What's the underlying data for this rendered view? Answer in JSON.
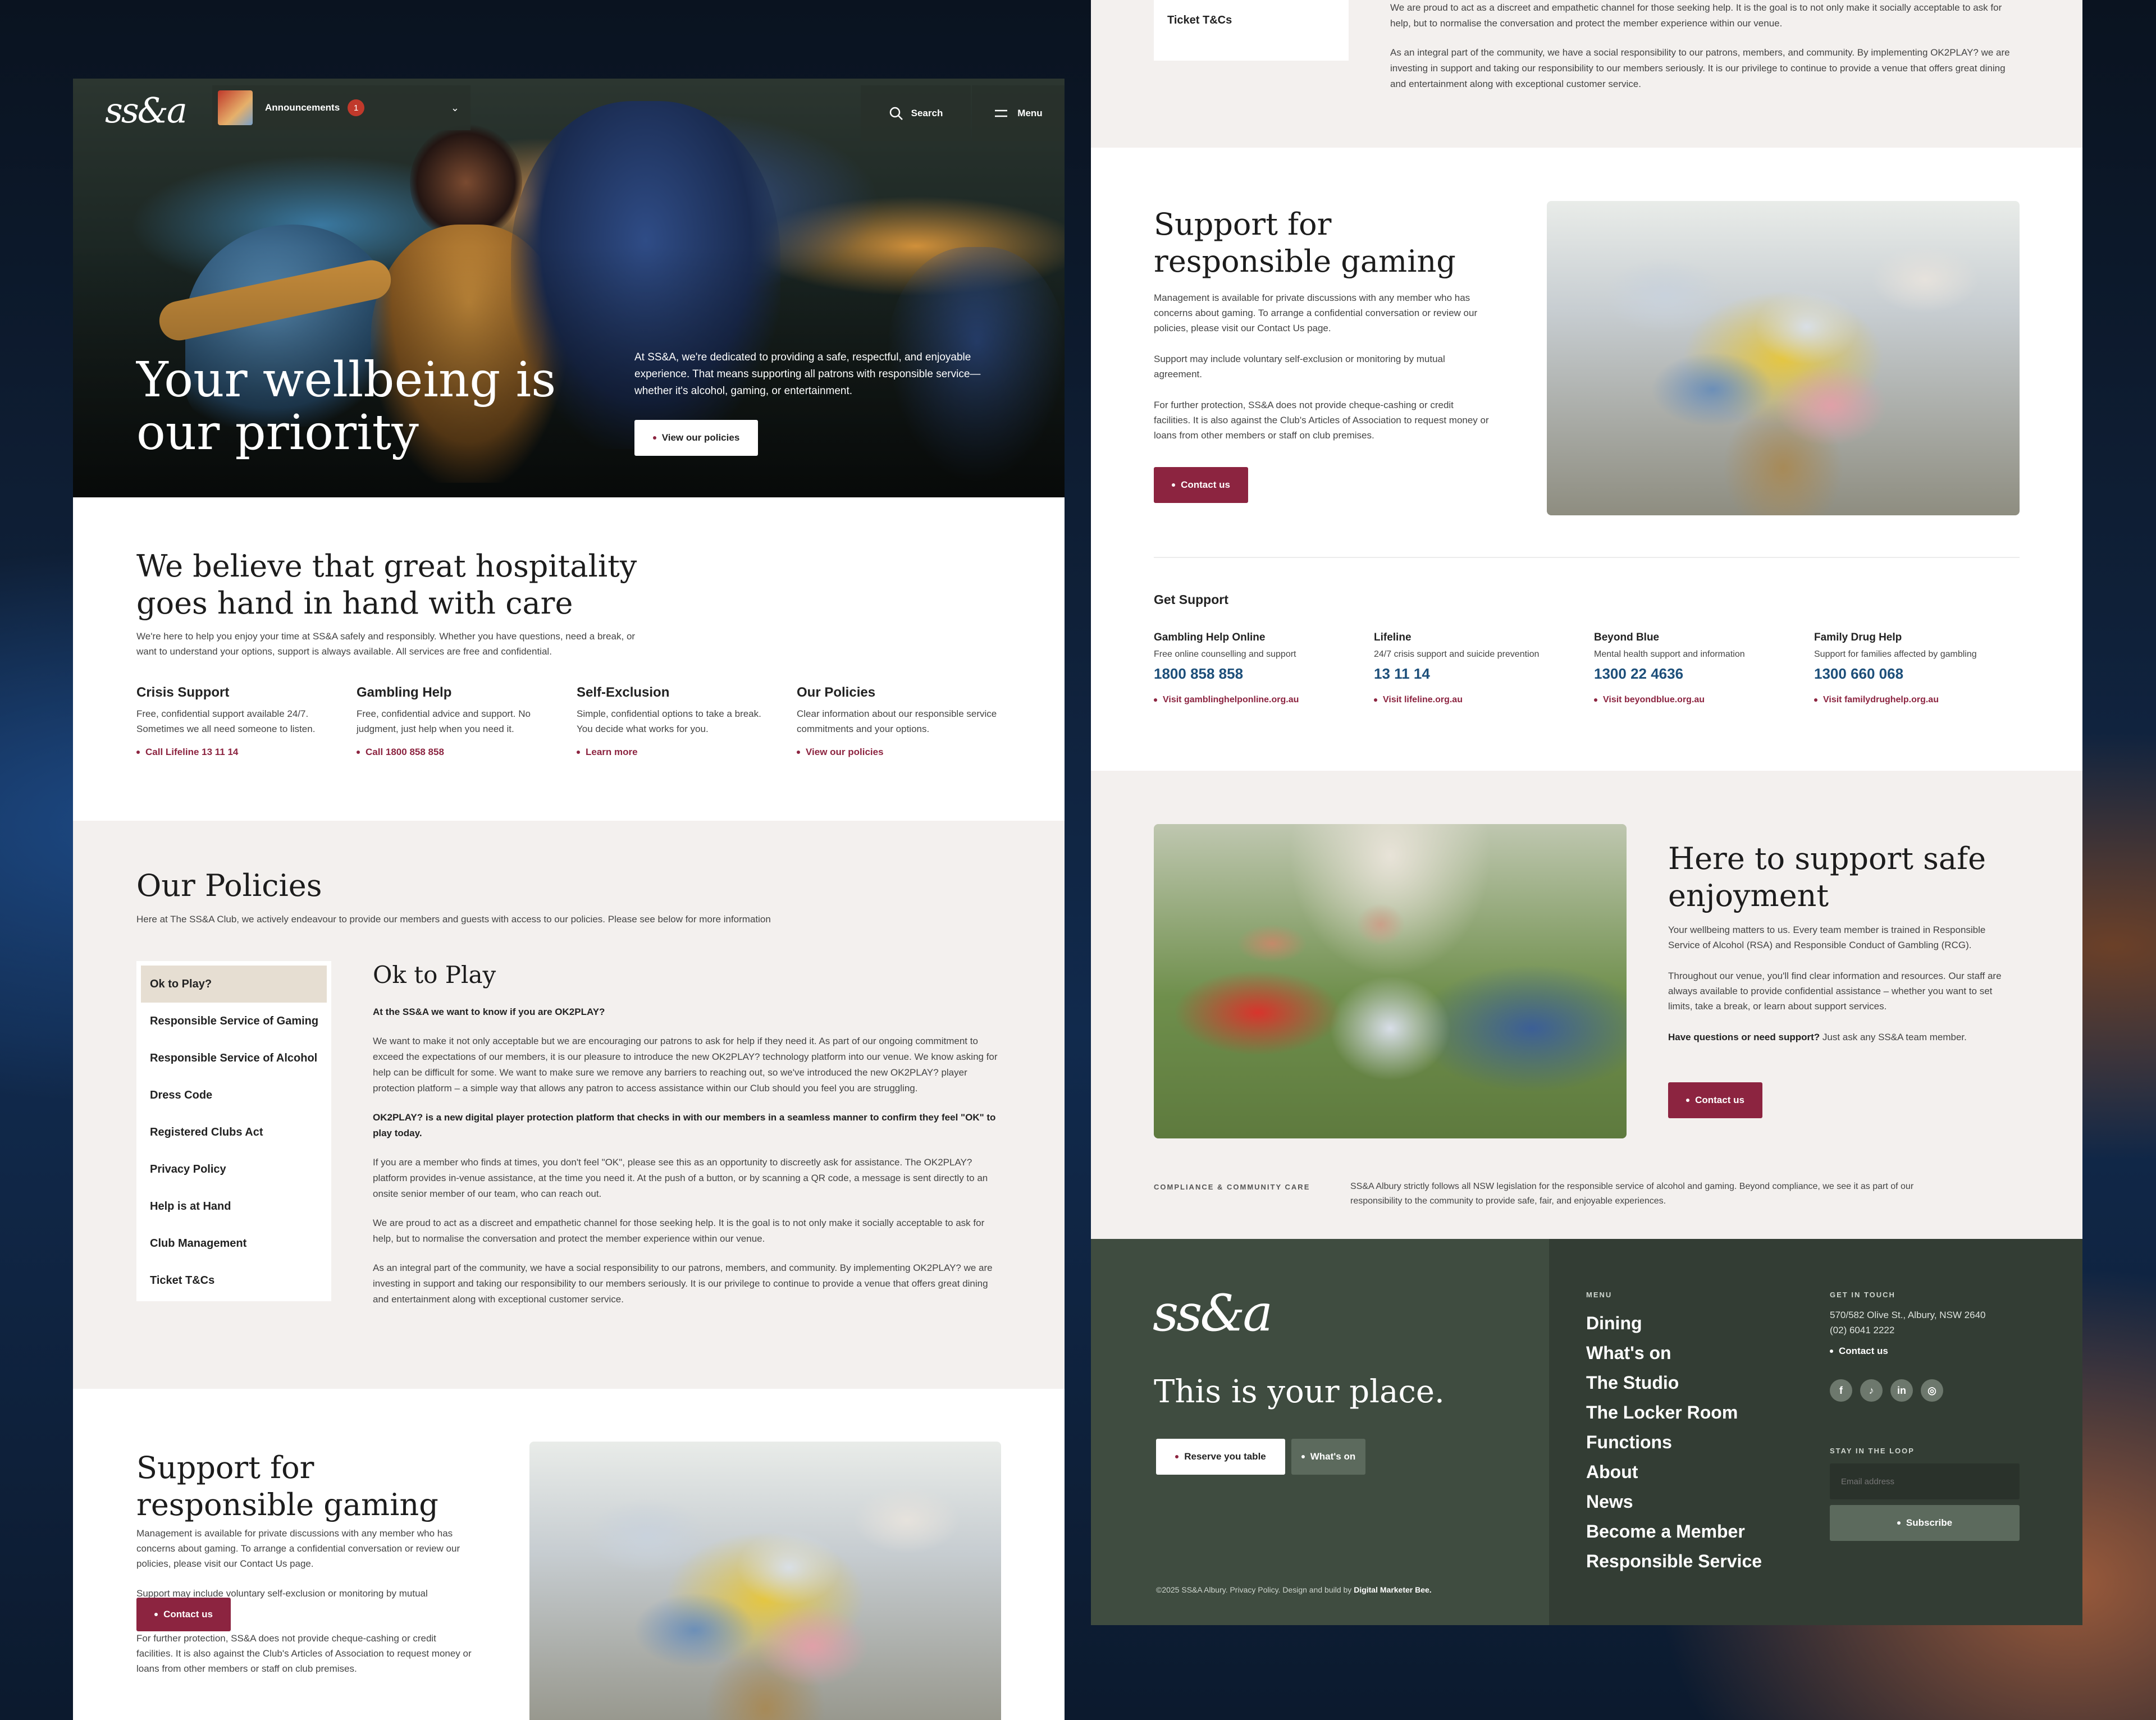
{
  "nav": {
    "logo": "ss&a",
    "announcements_label": "Announcements",
    "announcements_count": "1",
    "search_label": "Search",
    "menu_label": "Menu"
  },
  "hero": {
    "title_line1": "Your wellbeing is",
    "title_line2": "our priority",
    "body": "At SS&A, we're dedicated to providing a safe, respectful, and enjoyable experience. That means supporting all patrons with responsible service—whether it's alcohol, gaming, or entertainment.",
    "cta": "View our policies"
  },
  "care": {
    "title_line1": "We believe that great hospitality",
    "title_line2": "goes hand in hand with care",
    "intro": "We're here to help you enjoy your time at SS&A safely and responsibly. Whether you have questions, need a break, or want to understand your options, support is always available. All services are free and confidential.",
    "cards": [
      {
        "title": "Crisis Support",
        "text": "Free, confidential support available 24/7. Sometimes we all need someone to listen.",
        "link": "Call Lifeline 13 11 14"
      },
      {
        "title": "Gambling Help",
        "text": "Free, confidential advice and support. No judgment, just help when you need it.",
        "link": "Call 1800 858 858"
      },
      {
        "title": "Self-Exclusion",
        "text": "Simple, confidential options to take a break. You decide what works for you.",
        "link": "Learn more"
      },
      {
        "title": "Our Policies",
        "text": "Clear information about our responsible service commitments and your options.",
        "link": "View our policies"
      }
    ]
  },
  "policies": {
    "title": "Our Policies",
    "intro": "Here at The SS&A Club, we actively endeavour to provide our members and guests with access to our policies. Please see below for more information",
    "items": [
      "Ok to Play?",
      "Responsible Service of Gaming",
      "Responsible Service of Alcohol",
      "Dress Code",
      "Registered Clubs Act",
      "Privacy Policy",
      "Help is at Hand",
      "Club Management",
      "Ticket T&Cs"
    ],
    "content_title": "Ok to Play",
    "paragraphs": [
      "At the SS&A we want to know if you are OK2PLAY?",
      "We want to make it not only acceptable but we are encouraging our patrons to ask for help if they need it. As part of our ongoing commitment to exceed the expectations of our members, it is our pleasure to introduce the new OK2PLAY? technology platform into our venue. We know asking for help can be difficult for some. We want to make sure we remove any barriers to reaching out, so we've introduced the new OK2PLAY? player protection platform – a simple way that allows any patron to access assistance within our Club should you feel you are struggling.",
      "OK2PLAY? is a new digital player protection platform that checks in with our members in a seamless manner to confirm they feel \"OK\" to play today.",
      "If you are a member who finds at times, you don't feel \"OK\", please see this as an opportunity to discreetly ask for assistance. The OK2PLAY? platform provides in-venue assistance, at the time you need it. At the push of a button, or by scanning a QR code, a message is sent directly to an onsite senior member of our team, who can reach out.",
      "We are proud to act as a discreet and empathetic channel for those seeking help. It is the goal is to not only make it socially acceptable to ask for help, but to normalise the conversation and protect the member experience within our venue.",
      "As an integral part of the community, we have a social responsibility to our patrons, members, and community. By implementing OK2PLAY? we are investing in support and taking our responsibility to our members seriously. It is our privilege to continue to provide a venue that offers great dining and entertainment along with exceptional customer service."
    ]
  },
  "gaming": {
    "title_line1": "Support for",
    "title_line2": "responsible gaming",
    "p1": "Management is available for private discussions with any member who has concerns about gaming. To arrange a confidential conversation or review our policies, please visit our Contact Us page.",
    "p2": "Support may include voluntary self-exclusion or monitoring by mutual agreement.",
    "p3": "For further protection, SS&A does not provide cheque-cashing or credit facilities. It is also against the Club's Articles of Association to request money or loans from other members or staff on club premises.",
    "cta": "Contact us"
  },
  "get_support": {
    "title": "Get Support",
    "items": [
      {
        "name": "Gambling Help Online",
        "desc": "Free online counselling and support",
        "phone": "1800 858 858",
        "link": "Visit gamblinghelponline.org.au"
      },
      {
        "name": "Lifeline",
        "desc": "24/7 crisis support and suicide prevention",
        "phone": "13 11 14",
        "link": "Visit lifeline.org.au"
      },
      {
        "name": "Beyond Blue",
        "desc": "Mental health support and information",
        "phone": "1300 22 4636",
        "link": "Visit beyondblue.org.au"
      },
      {
        "name": "Family Drug Help",
        "desc": "Support for families affected by gambling",
        "phone": "1300 660 068",
        "link": "Visit familydrughelp.org.au"
      }
    ]
  },
  "safe": {
    "title_line1": "Here to support safe",
    "title_line2": "enjoyment",
    "p1": "Your wellbeing matters to us. Every team member is trained in Responsible Service of Alcohol (RSA) and Responsible Conduct of Gambling (RCG).",
    "p2": "Throughout our venue, you'll find clear information and resources. Our staff are always available to provide confidential assistance – whether you want to set limits, take a break, or learn about support services.",
    "p3_bold": "Have questions or need support?",
    "p3_rest": " Just ask any SS&A team member.",
    "cta": "Contact us"
  },
  "compliance": {
    "label": "COMPLIANCE & COMMUNITY CARE",
    "text": "SS&A Albury strictly follows all NSW legislation for the responsible service of alcohol and gaming. Beyond compliance, we see it as part of our responsibility to the community to provide safe, fair, and enjoyable experiences."
  },
  "footer": {
    "logo": "ss&a",
    "tagline": "This is your place.",
    "btn_primary": "Reserve you table",
    "btn_secondary": "What's on",
    "menu_label": "MENU",
    "menu": [
      "Dining",
      "What's on",
      "The Studio",
      "The Locker Room",
      "Functions",
      "About",
      "News",
      "Become a Member",
      "Responsible Service"
    ],
    "touch_label": "GET IN TOUCH",
    "address": "570/582 Olive St., Albury, NSW 2640",
    "phone": "(02) 6041 2222",
    "contact": "Contact us",
    "socials": [
      "f",
      "♪",
      "in",
      "◎"
    ],
    "loop_label": "STAY IN THE LOOP",
    "email_placeholder": "Email address",
    "subscribe": "Subscribe",
    "copyright": "©2025 SS&A Albury. Privacy Policy. Design and build by ",
    "credit": "Digital Marketer Bee."
  },
  "colors": {
    "accent": "#8c2440",
    "footer_bg": "#3f4c40",
    "beige": "#f3f0ee",
    "phone_blue": "#1d4f7a"
  }
}
